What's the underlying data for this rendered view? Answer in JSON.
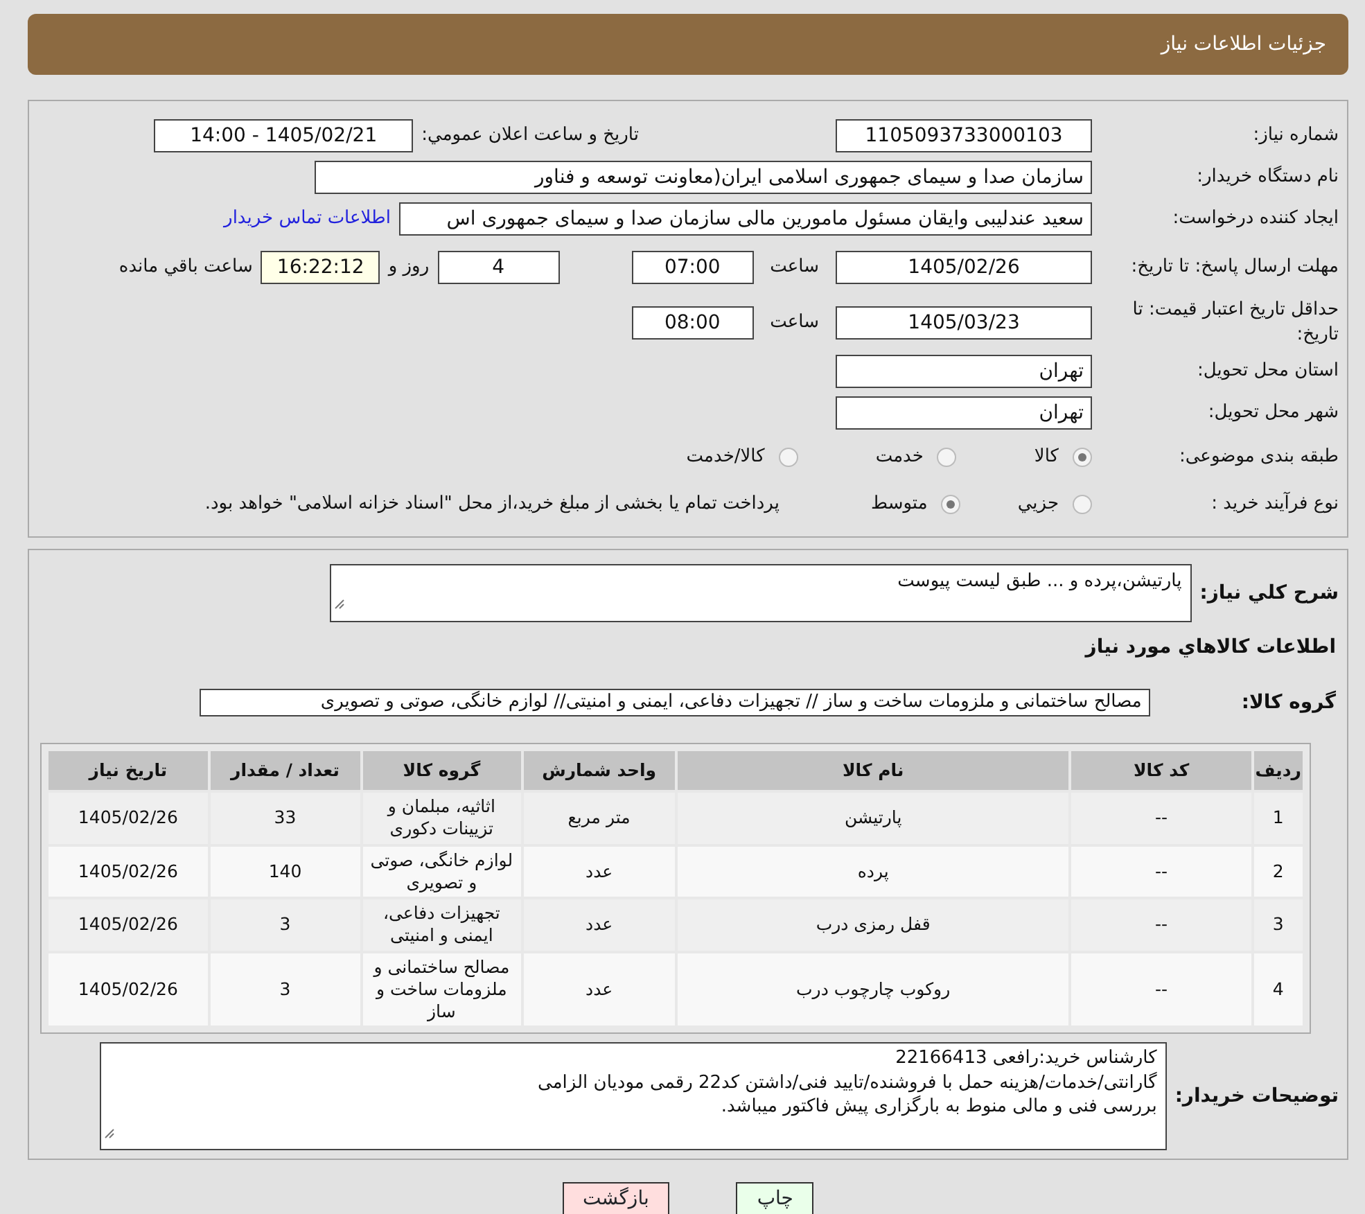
{
  "header": {
    "title": "جزئیات اطلاعات نیاز"
  },
  "need_number": {
    "label": "شماره نیاز:",
    "value": "1105093733000103"
  },
  "announce": {
    "label": "تاریخ و ساعت اعلان عمومي:",
    "value": "1405/02/21 - 14:00"
  },
  "buyer_org": {
    "label": "نام دستگاه خریدار:",
    "value": "سازمان صدا و سیمای جمهوری اسلامی ایران(معاونت توسعه و فناور"
  },
  "creator": {
    "label": "ایجاد کننده درخواست:",
    "value": "سعید عندلیبی وایقان مسئول مامورین مالی  سازمان صدا و سیمای جمهوری اس",
    "link": "اطلاعات تماس خریدار"
  },
  "deadline": {
    "label": "مهلت ارسال پاسخ: تا تاریخ:",
    "date": "1405/02/26",
    "time_label": "ساعت",
    "time": "07:00",
    "days": "4",
    "days_label": "روز و",
    "remaining": "16:22:12",
    "remaining_label": "ساعت باقي مانده"
  },
  "validity": {
    "label": "حداقل تاریخ اعتبار قیمت: تا تاریخ:",
    "date": "1405/03/23",
    "time_label": "ساعت",
    "time": "08:00"
  },
  "province": {
    "label": "استان محل تحویل:",
    "value": "تهران"
  },
  "city": {
    "label": "شهر محل تحویل:",
    "value": "تهران"
  },
  "category": {
    "label": "طبقه بندی موضوعی:",
    "options": [
      {
        "label": "کالا",
        "selected": true
      },
      {
        "label": "خدمت",
        "selected": false
      },
      {
        "label": "کالا/خدمت",
        "selected": false
      }
    ]
  },
  "purchase_type": {
    "label": "نوع فرآیند خرید :",
    "options": [
      {
        "label": "جزيي",
        "selected": false
      },
      {
        "label": "متوسط",
        "selected": true
      }
    ],
    "note": "پرداخت تمام یا بخشی از مبلغ خرید،از محل \"اسناد خزانه اسلامی\" خواهد بود."
  },
  "description": {
    "label": "شرح کلي نیاز:",
    "value": "پارتیشن،پرده و ... طبق لیست پیوست"
  },
  "goods_title": "اطلاعات کالاهاي مورد نیاز",
  "goods_group": {
    "label": "گروه کالا:",
    "value": "مصالح ساختمانی و ملزومات ساخت و ساز // تجهیزات دفاعی، ایمنی و امنیتی// لوازم خانگی، صوتی و تصویری"
  },
  "table": {
    "columns": [
      "ردیف",
      "کد کالا",
      "نام کالا",
      "واحد شمارش",
      "گروه کالا",
      "تعداد / مقدار",
      "تاریخ نیاز"
    ],
    "rows": [
      [
        "1",
        "--",
        "پارتیشن",
        "متر مربع",
        "اثاثیه، مبلمان و تزیینات دکوری",
        "33",
        "1405/02/26"
      ],
      [
        "2",
        "--",
        "پرده",
        "عدد",
        "لوازم خانگی، صوتی و تصویری",
        "140",
        "1405/02/26"
      ],
      [
        "3",
        "--",
        "قفل رمزی درب",
        "عدد",
        "تجهیزات دفاعی، ایمنی و امنیتی",
        "3",
        "1405/02/26"
      ],
      [
        "4",
        "--",
        "روکوب چارچوب درب",
        "عدد",
        "مصالح ساختمانی و ملزومات ساخت و ساز",
        "3",
        "1405/02/26"
      ]
    ]
  },
  "buyer_notes": {
    "label": "توضیحات خریدار:",
    "lines": [
      "کارشناس خرید:رافعی 22166413",
      "گارانتی/خدمات/هزینه حمل با فروشنده/تایید فنی/داشتن کد22 رقمی مودیان الزامی",
      "بررسی فنی و مالی منوط به بارگزاری پیش فاکتور میباشد."
    ]
  },
  "buttons": [
    {
      "label": "چاپ",
      "kind": "print"
    },
    {
      "label": "بازگشت",
      "kind": "back"
    }
  ]
}
